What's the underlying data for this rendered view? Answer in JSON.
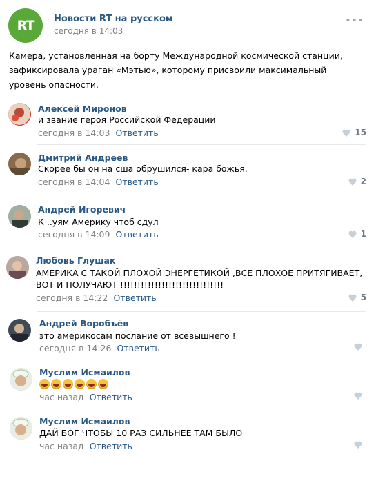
{
  "post": {
    "author": "Новости RT на русском",
    "logo_text": "RT",
    "date": "сегодня в 14:03",
    "text": "Камера, установленная на борту Международной космической станции, зафиксировала ураган «Мэтью», которому присвоили максимальный уровень опасности."
  },
  "reply_label": "Ответить",
  "colors": {
    "link": "#2a5885",
    "meta": "#828282",
    "rt_green": "#5aa73a"
  },
  "comments": [
    {
      "author": "Алексей Миронов",
      "text": "и звание героя Российской Федерации",
      "time": "сегодня в 14:03",
      "likes": "15"
    },
    {
      "author": "Дмитрий Андреев",
      "text": "Скорее бы он на сша обрушился- кара божья.",
      "time": "сегодня в 14:04",
      "likes": "2"
    },
    {
      "author": "Андрей Игоревич",
      "text": "К ..уям Америку чтоб сдул",
      "time": "сегодня в 14:09",
      "likes": "1"
    },
    {
      "author": "Любовь Глушак",
      "text_line1": "АМЕРИКА С ТАКОЙ ПЛОХОЙ ЭНЕРГЕТИКОЙ ,ВСЕ ПЛОХОЕ ПРИТЯГИВАЕТ,",
      "text_line2": "ВОТ И ПОЛУЧАЮТ !!!!!!!!!!!!!!!!!!!!!!!!!!!!!!",
      "time": "сегодня в 14:22",
      "likes": "5"
    },
    {
      "author": "Андрей Воробъёв",
      "text": "это америкосам послание от всевышнего !",
      "time": "сегодня в 14:26",
      "likes": ""
    },
    {
      "author": "Муслим Исмаилов",
      "emoji_count": 6,
      "time": "час назад",
      "likes": ""
    },
    {
      "author": "Муслим Исмаилов",
      "text": "ДАЙ БОГ ЧТОБЫ 10 РАЗ СИЛЬНЕЕ ТАМ БЫЛО",
      "time": "час назад",
      "likes": ""
    }
  ]
}
